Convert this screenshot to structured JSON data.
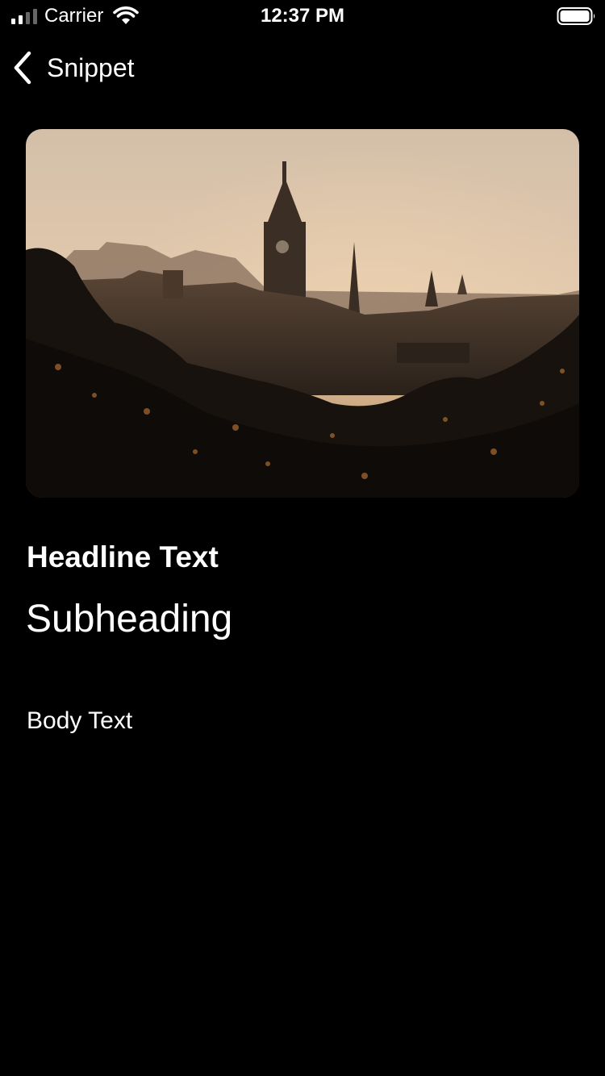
{
  "status_bar": {
    "carrier": "Carrier",
    "time": "12:37 PM",
    "icons": [
      "cellular-signal-icon",
      "wifi-icon",
      "battery-icon"
    ]
  },
  "nav": {
    "back_label": "Snippet",
    "back_icon": "chevron-left-icon"
  },
  "hero": {
    "description_icon": "photo-image",
    "colors": {
      "sky_top": "#d9c7b2",
      "sky_bottom": "#e6cdb2",
      "foreground": "#0f0c09"
    }
  },
  "content": {
    "headline": "Headline Text",
    "subheading": "Subheading",
    "body": "Body Text"
  },
  "theme": {
    "background": "#000000",
    "text": "#ffffff"
  }
}
